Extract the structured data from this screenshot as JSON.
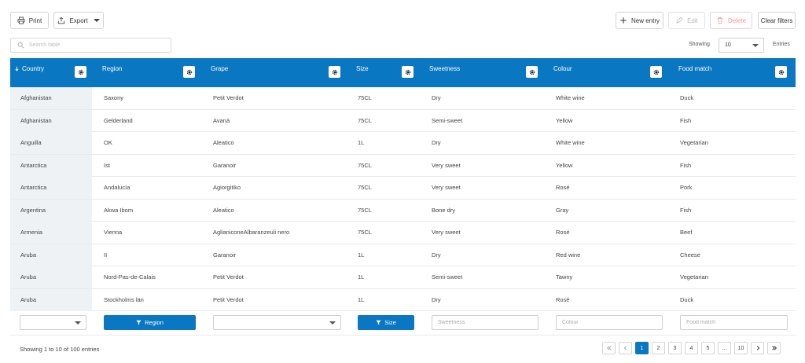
{
  "toolbar": {
    "print_label": "Print",
    "export_label": "Export",
    "new_entry_label": "New entry",
    "edit_label": "Edit",
    "delete_label": "Delete",
    "clear_filters_label": "Clear filters"
  },
  "search": {
    "placeholder": "Search table"
  },
  "entries": {
    "showing_label": "Showing",
    "page_size": "10",
    "entries_label": "Entries"
  },
  "table": {
    "columns": [
      "Country",
      "Region",
      "Grape",
      "Size",
      "Sweetness",
      "Colour",
      "Food match"
    ],
    "rows": [
      [
        "Afghanistan",
        "Saxony",
        "Petit Verdot",
        "75CL",
        "Dry",
        "White wine",
        "Duck"
      ],
      [
        "Afghanistan",
        "Gelderland",
        "Avanà",
        "75CL",
        "Semi-sweet",
        "Yellow",
        "Fish"
      ],
      [
        "Anguilla",
        "OK",
        "Aleatico",
        "1L",
        "Dry",
        "White wine",
        "Vegetarian"
      ],
      [
        "Antarctica",
        "Ist",
        "Garanoir",
        "75CL",
        "Very sweet",
        "Yellow",
        "Fish"
      ],
      [
        "Antarctica",
        "Andalucía",
        "Agiorgitiko",
        "75CL",
        "Very sweet",
        "Rosé",
        "Pork"
      ],
      [
        "Argentina",
        "Akwa Ibom",
        "Aleatico",
        "75CL",
        "Bone dry",
        "Gray",
        "Fish"
      ],
      [
        "Armenia",
        "Vienna",
        "AglianiconeAlbaranzeuli nero",
        "75CL",
        "Very sweet",
        "Rosé",
        "Beef"
      ],
      [
        "Aruba",
        "II",
        "Garanoir",
        "1L",
        "Dry",
        "Red wine",
        "Cheese"
      ],
      [
        "Aruba",
        "Nord-Pas-de-Calais",
        "Petit Verdot",
        "1L",
        "Semi-sweet",
        "Tawny",
        "Vegetarian"
      ],
      [
        "Aruba",
        "Stockholms län",
        "Petit Verdot",
        "1L",
        "Dry",
        "Rosé",
        "Duck"
      ]
    ]
  },
  "filters": {
    "region_button": "Region",
    "size_button": "Size",
    "sweetness_placeholder": "Sweetness",
    "colour_placeholder": "Colour",
    "food_match_placeholder": "Food match"
  },
  "footer": {
    "summary": "Showing 1 to 10 of 100 entries"
  },
  "pagination": {
    "pages": [
      "1",
      "2",
      "3",
      "4",
      "5",
      "...",
      "10"
    ],
    "active": "1"
  },
  "colors": {
    "accent": "#0a77c2",
    "first_column_bg": "#eef2f5"
  },
  "icons": {
    "print": "printer-icon",
    "export": "export-icon",
    "new_entry": "plus-icon",
    "edit": "pencil-icon",
    "delete": "trash-icon",
    "search": "search-icon",
    "column_settings": "gear-icon",
    "filter": "filter-icon",
    "sort": "sort-down-icon"
  }
}
